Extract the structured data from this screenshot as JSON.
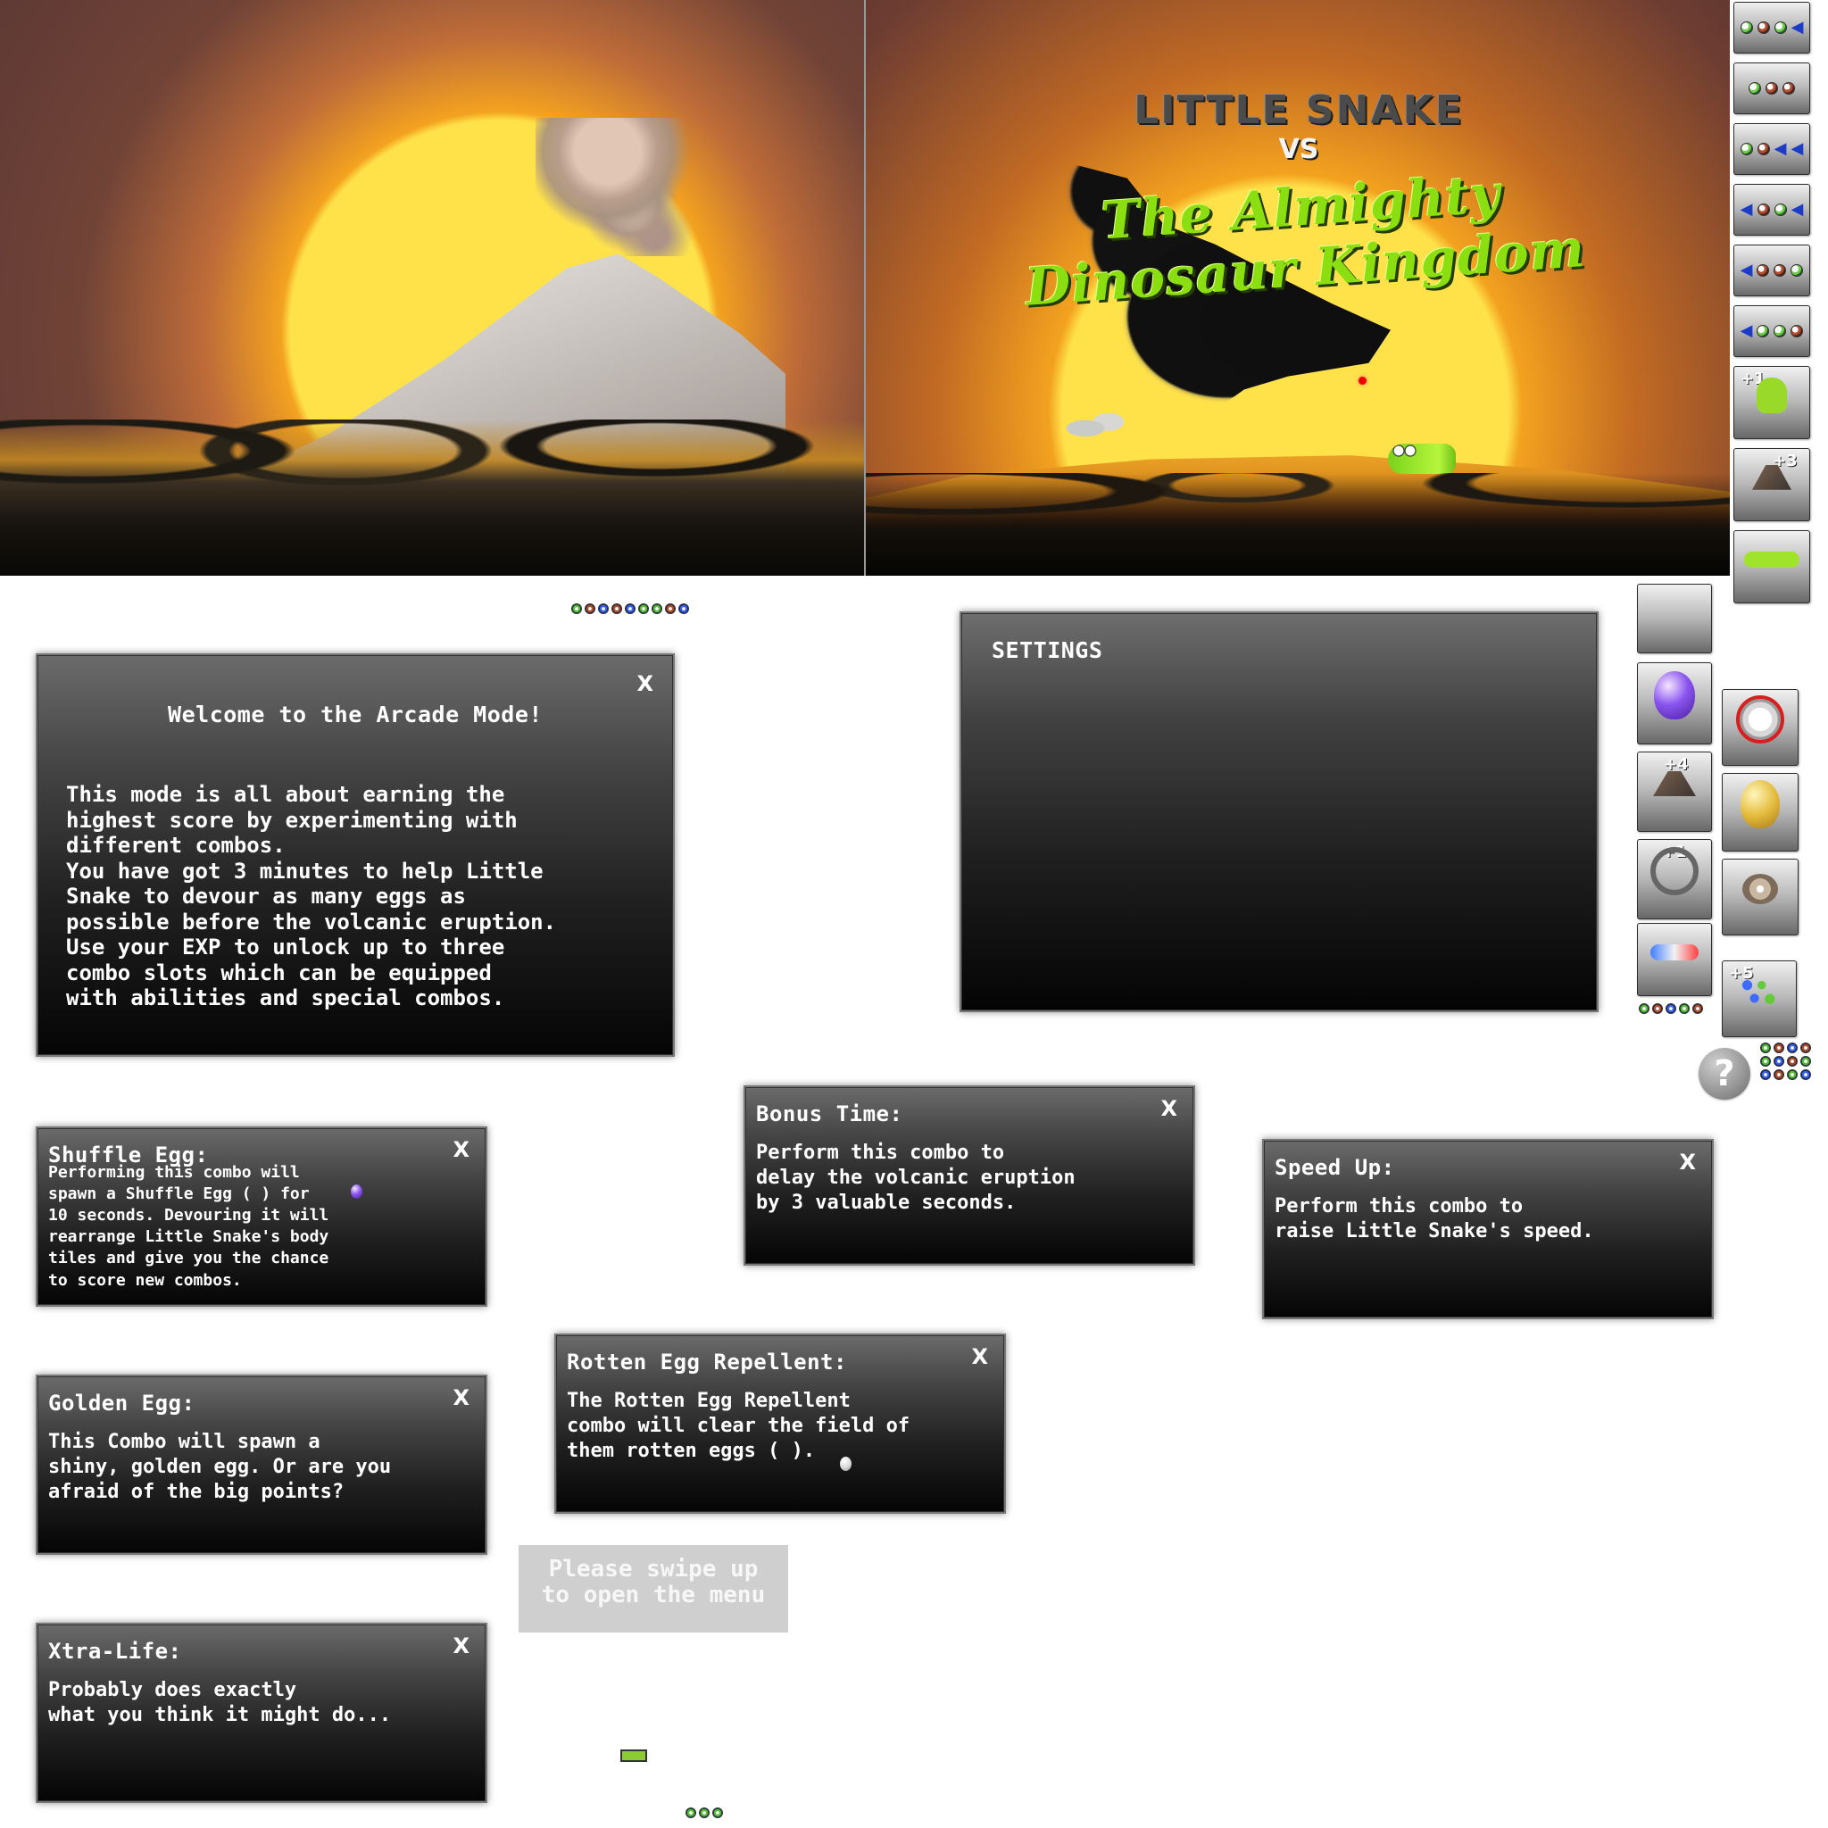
{
  "title": {
    "main": "LITTLE SNAKE",
    "vs": "VS",
    "subtitle": "The Almighty Dinosaur Kingdom"
  },
  "dialogs": {
    "welcome": {
      "title": "Welcome to the Arcade Mode!",
      "close": "X",
      "body": "This mode is all about earning the\nhighest score by experimenting with\ndifferent combos.\nYou have got 3 minutes to help Little\nSnake to devour as many eggs as\npossible before the volcanic eruption.\nUse your EXP to unlock up to three\ncombo slots which can be equipped\nwith abilities and special combos."
    },
    "settings": {
      "title": "SETTINGS"
    },
    "shuffle": {
      "title": "Shuffle Egg:",
      "close": "X",
      "body": "Performing this combo will\nspawn a Shuffle Egg ( ) for\n10 seconds. Devouring it will\nrearrange Little Snake's body\ntiles and give you the chance\nto score new combos."
    },
    "golden": {
      "title": "Golden Egg:",
      "close": "X",
      "body": "This Combo will spawn a\nshiny, golden egg. Or are you\nafraid of the big points?"
    },
    "xtra_life": {
      "title": "Xtra-Life:",
      "close": "X",
      "body": "Probably does exactly\nwhat you think it might do..."
    },
    "bonus_time": {
      "title": "Bonus Time:",
      "close": "X",
      "body": "Perform this combo to\ndelay the volcanic eruption\nby 3 valuable seconds."
    },
    "rotten_repellent": {
      "title": "Rotten Egg Repellent:",
      "close": "X",
      "body": "The Rotten Egg Repellent\ncombo will clear the field of\nthem rotten eggs ( )."
    },
    "speed_up": {
      "title": "Speed Up:",
      "close": "X",
      "body": "Perform this combo to\nraise Little Snake's speed."
    }
  },
  "hint": {
    "swipe": "Please swipe up\nto open the menu"
  },
  "icons": {
    "help": "?",
    "plus_one": "+1",
    "plus_three": "+3",
    "plus_four": "+4",
    "plus_five": "+5"
  },
  "colors": {
    "accent_green": "#8bdf10",
    "dialog_dark": "#050505",
    "sunset_orange": "#f3a21f"
  }
}
